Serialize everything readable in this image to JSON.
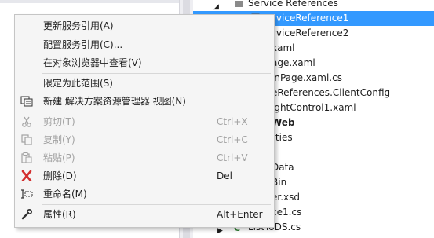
{
  "context_menu": {
    "update_service_reference": "更新服务引用(A)",
    "configure_service_reference": "配置服务引用(C)...",
    "view_in_object_browser": "在对象浏览器中查看(V)",
    "scope_to_this": "限定为此范围(S)",
    "new_solution_explorer_view": "新建 解决方案资源管理器 视图(N)",
    "cut": {
      "label": "剪切(T)",
      "shortcut": "Ctrl+X"
    },
    "copy": {
      "label": "复制(Y)",
      "shortcut": "Ctrl+C"
    },
    "paste": {
      "label": "粘贴(P)",
      "shortcut": "Ctrl+V"
    },
    "delete": {
      "label": "删除(D)",
      "shortcut": "Del"
    },
    "rename": {
      "label": "重命名(M)"
    },
    "properties": {
      "label": "属性(R)",
      "shortcut": "Alt+Enter"
    }
  },
  "solution_tree": {
    "items": [
      "Service References",
      "ServiceReference1",
      "ServiceReference2",
      "xaml",
      "age.xaml",
      "inPage.xaml.cs",
      "eReferences.ClientConfig",
      "ightControl1.xaml",
      "Web",
      "rties",
      "Data",
      "Bin",
      "er.xsd",
      "ce1.cs",
      "ListToDS.cs"
    ]
  },
  "colors": {
    "selection": "#3399ff",
    "menu_background": "#f5f5f5",
    "disabled_text": "#a2a2a2",
    "delete_icon": "#d32f2f"
  }
}
